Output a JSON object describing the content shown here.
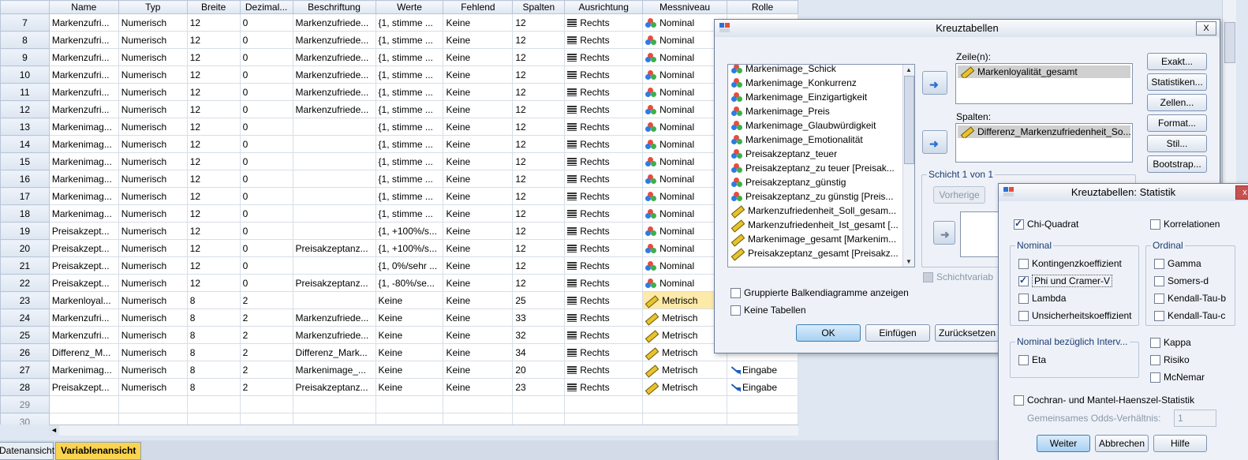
{
  "table": {
    "headers": [
      "",
      "Name",
      "Typ",
      "Breite",
      "Dezimal...",
      "Beschriftung",
      "Werte",
      "Fehlend",
      "Spalten",
      "Ausrichtung",
      "Messniveau",
      "Rolle"
    ],
    "rows": [
      {
        "n": "7",
        "name": "Markenzufri...",
        "typ": "Numerisch",
        "breite": "12",
        "dez": "0",
        "besch": "Markenzufriede...",
        "werte": "{1, stimme ...",
        "fehl": "Keine",
        "spalten": "12",
        "ausr": "Rechts",
        "mess": "Nominal",
        "rolle": ""
      },
      {
        "n": "8",
        "name": "Markenzufri...",
        "typ": "Numerisch",
        "breite": "12",
        "dez": "0",
        "besch": "Markenzufriede...",
        "werte": "{1, stimme ...",
        "fehl": "Keine",
        "spalten": "12",
        "ausr": "Rechts",
        "mess": "Nominal",
        "rolle": ""
      },
      {
        "n": "9",
        "name": "Markenzufri...",
        "typ": "Numerisch",
        "breite": "12",
        "dez": "0",
        "besch": "Markenzufriede...",
        "werte": "{1, stimme ...",
        "fehl": "Keine",
        "spalten": "12",
        "ausr": "Rechts",
        "mess": "Nominal",
        "rolle": ""
      },
      {
        "n": "10",
        "name": "Markenzufri...",
        "typ": "Numerisch",
        "breite": "12",
        "dez": "0",
        "besch": "Markenzufriede...",
        "werte": "{1, stimme ...",
        "fehl": "Keine",
        "spalten": "12",
        "ausr": "Rechts",
        "mess": "Nominal",
        "rolle": ""
      },
      {
        "n": "11",
        "name": "Markenzufri...",
        "typ": "Numerisch",
        "breite": "12",
        "dez": "0",
        "besch": "Markenzufriede...",
        "werte": "{1, stimme ...",
        "fehl": "Keine",
        "spalten": "12",
        "ausr": "Rechts",
        "mess": "Nominal",
        "rolle": ""
      },
      {
        "n": "12",
        "name": "Markenzufri...",
        "typ": "Numerisch",
        "breite": "12",
        "dez": "0",
        "besch": "Markenzufriede...",
        "werte": "{1, stimme ...",
        "fehl": "Keine",
        "spalten": "12",
        "ausr": "Rechts",
        "mess": "Nominal",
        "rolle": ""
      },
      {
        "n": "13",
        "name": "Markenimag...",
        "typ": "Numerisch",
        "breite": "12",
        "dez": "0",
        "besch": "",
        "werte": "{1, stimme ...",
        "fehl": "Keine",
        "spalten": "12",
        "ausr": "Rechts",
        "mess": "Nominal",
        "rolle": ""
      },
      {
        "n": "14",
        "name": "Markenimag...",
        "typ": "Numerisch",
        "breite": "12",
        "dez": "0",
        "besch": "",
        "werte": "{1, stimme ...",
        "fehl": "Keine",
        "spalten": "12",
        "ausr": "Rechts",
        "mess": "Nominal",
        "rolle": ""
      },
      {
        "n": "15",
        "name": "Markenimag...",
        "typ": "Numerisch",
        "breite": "12",
        "dez": "0",
        "besch": "",
        "werte": "{1, stimme ...",
        "fehl": "Keine",
        "spalten": "12",
        "ausr": "Rechts",
        "mess": "Nominal",
        "rolle": ""
      },
      {
        "n": "16",
        "name": "Markenimag...",
        "typ": "Numerisch",
        "breite": "12",
        "dez": "0",
        "besch": "",
        "werte": "{1, stimme ...",
        "fehl": "Keine",
        "spalten": "12",
        "ausr": "Rechts",
        "mess": "Nominal",
        "rolle": ""
      },
      {
        "n": "17",
        "name": "Markenimag...",
        "typ": "Numerisch",
        "breite": "12",
        "dez": "0",
        "besch": "",
        "werte": "{1, stimme ...",
        "fehl": "Keine",
        "spalten": "12",
        "ausr": "Rechts",
        "mess": "Nominal",
        "rolle": ""
      },
      {
        "n": "18",
        "name": "Markenimag...",
        "typ": "Numerisch",
        "breite": "12",
        "dez": "0",
        "besch": "",
        "werte": "{1, stimme ...",
        "fehl": "Keine",
        "spalten": "12",
        "ausr": "Rechts",
        "mess": "Nominal",
        "rolle": ""
      },
      {
        "n": "19",
        "name": "Preisakzept...",
        "typ": "Numerisch",
        "breite": "12",
        "dez": "0",
        "besch": "",
        "werte": "{1, +100%/s...",
        "fehl": "Keine",
        "spalten": "12",
        "ausr": "Rechts",
        "mess": "Nominal",
        "rolle": ""
      },
      {
        "n": "20",
        "name": "Preisakzept...",
        "typ": "Numerisch",
        "breite": "12",
        "dez": "0",
        "besch": "Preisakzeptanz...",
        "werte": "{1, +100%/s...",
        "fehl": "Keine",
        "spalten": "12",
        "ausr": "Rechts",
        "mess": "Nominal",
        "rolle": ""
      },
      {
        "n": "21",
        "name": "Preisakzept...",
        "typ": "Numerisch",
        "breite": "12",
        "dez": "0",
        "besch": "",
        "werte": "{1, 0%/sehr ...",
        "fehl": "Keine",
        "spalten": "12",
        "ausr": "Rechts",
        "mess": "Nominal",
        "rolle": ""
      },
      {
        "n": "22",
        "name": "Preisakzept...",
        "typ": "Numerisch",
        "breite": "12",
        "dez": "0",
        "besch": "Preisakzeptanz...",
        "werte": "{1, -80%/se...",
        "fehl": "Keine",
        "spalten": "12",
        "ausr": "Rechts",
        "mess": "Nominal",
        "rolle": ""
      },
      {
        "n": "23",
        "name": "Markenloyal...",
        "typ": "Numerisch",
        "breite": "8",
        "dez": "2",
        "besch": "",
        "werte": "Keine",
        "fehl": "Keine",
        "spalten": "25",
        "ausr": "Rechts",
        "mess": "Metrisch",
        "rolle": ""
      },
      {
        "n": "24",
        "name": "Markenzufri...",
        "typ": "Numerisch",
        "breite": "8",
        "dez": "2",
        "besch": "Markenzufriede...",
        "werte": "Keine",
        "fehl": "Keine",
        "spalten": "33",
        "ausr": "Rechts",
        "mess": "Metrisch",
        "rolle": ""
      },
      {
        "n": "25",
        "name": "Markenzufri...",
        "typ": "Numerisch",
        "breite": "8",
        "dez": "2",
        "besch": "Markenzufriede...",
        "werte": "Keine",
        "fehl": "Keine",
        "spalten": "32",
        "ausr": "Rechts",
        "mess": "Metrisch",
        "rolle": ""
      },
      {
        "n": "26",
        "name": "Differenz_M...",
        "typ": "Numerisch",
        "breite": "8",
        "dez": "2",
        "besch": "Differenz_Mark...",
        "werte": "Keine",
        "fehl": "Keine",
        "spalten": "34",
        "ausr": "Rechts",
        "mess": "Metrisch",
        "rolle": ""
      },
      {
        "n": "27",
        "name": "Markenimag...",
        "typ": "Numerisch",
        "breite": "8",
        "dez": "2",
        "besch": "Markenimage_...",
        "werte": "Keine",
        "fehl": "Keine",
        "spalten": "20",
        "ausr": "Rechts",
        "mess": "Metrisch",
        "rolle": "Eingabe"
      },
      {
        "n": "28",
        "name": "Preisakzept...",
        "typ": "Numerisch",
        "breite": "8",
        "dez": "2",
        "besch": "Preisakzeptanz...",
        "werte": "Keine",
        "fehl": "Keine",
        "spalten": "23",
        "ausr": "Rechts",
        "mess": "Metrisch",
        "rolle": "Eingabe"
      }
    ],
    "empty_rows": [
      "29",
      "30"
    ],
    "hscroll_arrow": "◄"
  },
  "tabs": {
    "data_view": "Datenansicht",
    "variable_view": "Variablenansicht"
  },
  "kreuz": {
    "title": "Kreuztabellen",
    "close": "X",
    "source_items": [
      {
        "label": "Markenimage_Schick",
        "type": "nominal"
      },
      {
        "label": "Markenimage_Konkurrenz",
        "type": "nominal"
      },
      {
        "label": "Markenimage_Einzigartigkeit",
        "type": "nominal"
      },
      {
        "label": "Markenimage_Preis",
        "type": "nominal"
      },
      {
        "label": "Markenimage_Glaubwürdigkeit",
        "type": "nominal"
      },
      {
        "label": "Markenimage_Emotionalität",
        "type": "nominal"
      },
      {
        "label": "Preisakzeptanz_teuer",
        "type": "nominal"
      },
      {
        "label": "Preisakzeptanz_zu teuer [Preisak...",
        "type": "nominal"
      },
      {
        "label": "Preisakzeptanz_günstig",
        "type": "nominal"
      },
      {
        "label": "Preisakzeptanz_zu günstig [Preis...",
        "type": "nominal"
      },
      {
        "label": "Markenzufriedenheit_Soll_gesam...",
        "type": "scale"
      },
      {
        "label": "Markenzufriedenheit_Ist_gesamt [...",
        "type": "scale"
      },
      {
        "label": "Markenimage_gesamt [Markenim...",
        "type": "scale"
      },
      {
        "label": "Preisakzeptanz_gesamt [Preisakz...",
        "type": "scale"
      }
    ],
    "rows_label": "Zeile(n):",
    "rows_value": "Markenloyalität_gesamt",
    "cols_label": "Spalten:",
    "cols_value": "Differenz_Markenzufriedenheit_So...",
    "layer_label": "Schicht 1 von 1",
    "prev_btn": "Vorherige",
    "layer_var": "Schichtvariab",
    "chk_grouped": "Gruppierte Balkendiagramme anzeigen",
    "chk_no_tables": "Keine Tabellen",
    "btn_ok": "OK",
    "btn_insert": "Einfügen",
    "btn_reset": "Zurücksetzen",
    "side_buttons": [
      "Exakt...",
      "Statistiken...",
      "Zellen...",
      "Format...",
      "Stil...",
      "Bootstrap..."
    ]
  },
  "stat": {
    "title": "Kreuztabellen: Statistik",
    "close": "x",
    "chi": "Chi-Quadrat",
    "korr": "Korrelationen",
    "nominal_group": "Nominal",
    "nominal": [
      "Kontingenzkoeffizient",
      "Phi und Cramer-V",
      "Lambda",
      "Unsicherheitskoeffizient"
    ],
    "ordinal_group": "Ordinal",
    "ordinal": [
      "Gamma",
      "Somers-d",
      "Kendall-Tau-b",
      "Kendall-Tau-c"
    ],
    "interval_group": "Nominal bezüglich Interv...",
    "eta": "Eta",
    "kappa": "Kappa",
    "risiko": "Risiko",
    "mcnemar": "McNemar",
    "cochran": "Cochran- und Mantel-Haenszel-Statistik",
    "odds_label": "Gemeinsames Odds-Verhältnis:",
    "odds_value": "1",
    "btn_weiter": "Weiter",
    "btn_abbrechen": "Abbrechen",
    "btn_hilfe": "Hilfe"
  },
  "colors": {
    "highlight": "#fde9a8",
    "active_tab": "#fbd44f",
    "close_red": "#c75050"
  }
}
